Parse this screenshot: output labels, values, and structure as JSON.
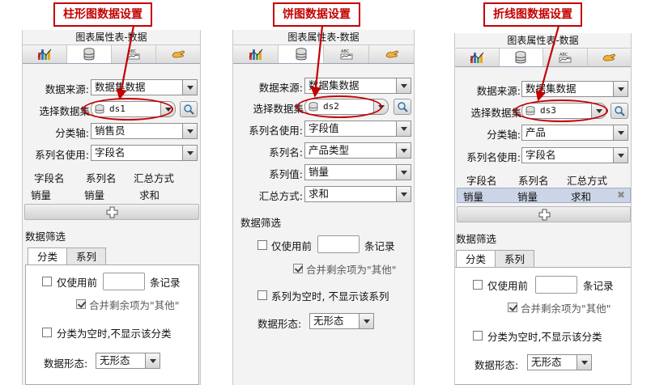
{
  "captions": {
    "bar": "柱形图数据设置",
    "pie": "饼图数据设置",
    "line": "折线图数据设置"
  },
  "panel_title": "图表属性表-数据",
  "icons": {
    "tab1": "chart-icon",
    "tab2": "database-icon",
    "tab3": "style-icon",
    "tab4": "hand-icon"
  },
  "colors": {
    "annotation": "#c40000",
    "row_highlight": "#ccd5e7"
  },
  "bar": {
    "source_label": "数据来源:",
    "source_value": "数据集数据",
    "dataset_label": "选择数据集",
    "dataset_value": "ds1",
    "cat_label": "分类轴:",
    "cat_value": "销售员",
    "sname_label": "系列名使用:",
    "sname_value": "字段名",
    "col_field": "字段名",
    "col_series": "系列名",
    "col_agg": "汇总方式",
    "cell_field": "销量",
    "cell_series": "销量",
    "cell_agg": "求和",
    "filter_title": "数据筛选",
    "tab_category": "分类",
    "tab_series": "系列",
    "use_first": "仅使用前",
    "records": "条记录",
    "merge": "合并剩余项为\"其他\"",
    "empty_hide": "分类为空时,不显示该分类",
    "form_label": "数据形态:",
    "form_value": "无形态"
  },
  "pie": {
    "source_label": "数据来源:",
    "source_value": "数据集数据",
    "dataset_label": "选择数据集",
    "dataset_value": "ds2",
    "sname_label": "系列名使用:",
    "sname_value": "字段值",
    "series_label": "系列名:",
    "series_value": "产品类型",
    "value_label": "系列值:",
    "value_value": "销量",
    "agg_label": "汇总方式:",
    "agg_value": "求和",
    "filter_title": "数据筛选",
    "use_first": "仅使用前",
    "records": "条记录",
    "merge": "合并剩余项为\"其他\"",
    "empty_hide": "系列为空时, 不显示该系列",
    "form_label": "数据形态:",
    "form_value": "无形态"
  },
  "line": {
    "source_label": "数据来源:",
    "source_value": "数据集数据",
    "dataset_label": "选择数据集",
    "dataset_value": "ds3",
    "cat_label": "分类轴:",
    "cat_value": "产品",
    "sname_label": "系列名使用:",
    "sname_value": "字段名",
    "col_field": "字段名",
    "col_series": "系列名",
    "col_agg": "汇总方式",
    "cell_field": "销量",
    "cell_series": "销量",
    "cell_agg": "求和",
    "remove": "✖",
    "filter_title": "数据筛选",
    "tab_category": "分类",
    "tab_series": "系列",
    "use_first": "仅使用前",
    "records": "条记录",
    "merge": "合并剩余项为\"其他\"",
    "empty_hide": "分类为空时,不显示该分类",
    "form_label": "数据形态:",
    "form_value": "无形态"
  }
}
